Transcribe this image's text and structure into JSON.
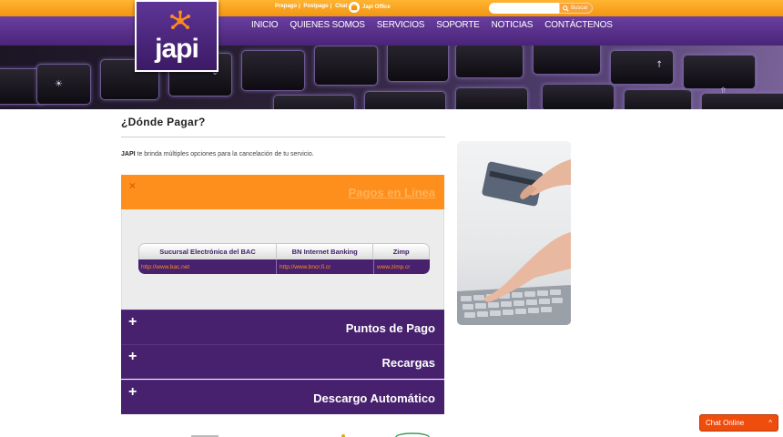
{
  "topbar": {
    "links": [
      "Prepago",
      "Postpago",
      "Chat"
    ],
    "office_label": "Japi Office",
    "search_placeholder": "",
    "search_button": "Buscar"
  },
  "logo": {
    "text": "japi"
  },
  "nav": [
    "INICIO",
    "QUIENES SOMOS",
    "SERVICIOS",
    "SOPORTE",
    "NOTICIAS",
    "CONTÁCTENOS"
  ],
  "hero": {
    "keys": [
      "☀",
      "⌄",
      "↑",
      "⇧"
    ]
  },
  "page": {
    "title": "¿Dónde Pagar?",
    "intro_brand": "JAPI",
    "intro_text": " te brinda múltiples opciones para la cancelación de tu servicio."
  },
  "accordion": {
    "open": {
      "icon": "×",
      "title": "Pagos en Línea"
    },
    "table": {
      "headers": [
        "Sucursal Electrónica del BAC",
        "BN Internet Banking",
        "Zimp"
      ],
      "rows": [
        [
          "http://www.bac.net",
          "http://www.bncr.fi.cr",
          "www.zimp.cr"
        ]
      ]
    },
    "closed": [
      {
        "icon": "+",
        "title": "Puntos de Pago"
      },
      {
        "icon": "+",
        "title": "Recargas"
      },
      {
        "icon": "+",
        "title": "Descargo Automático"
      }
    ]
  },
  "chat": {
    "label": "Chat Online",
    "icon": "^"
  },
  "colors": {
    "orange": "#ff8f1c",
    "purple": "#47206e",
    "chat": "#ee4d0e"
  }
}
